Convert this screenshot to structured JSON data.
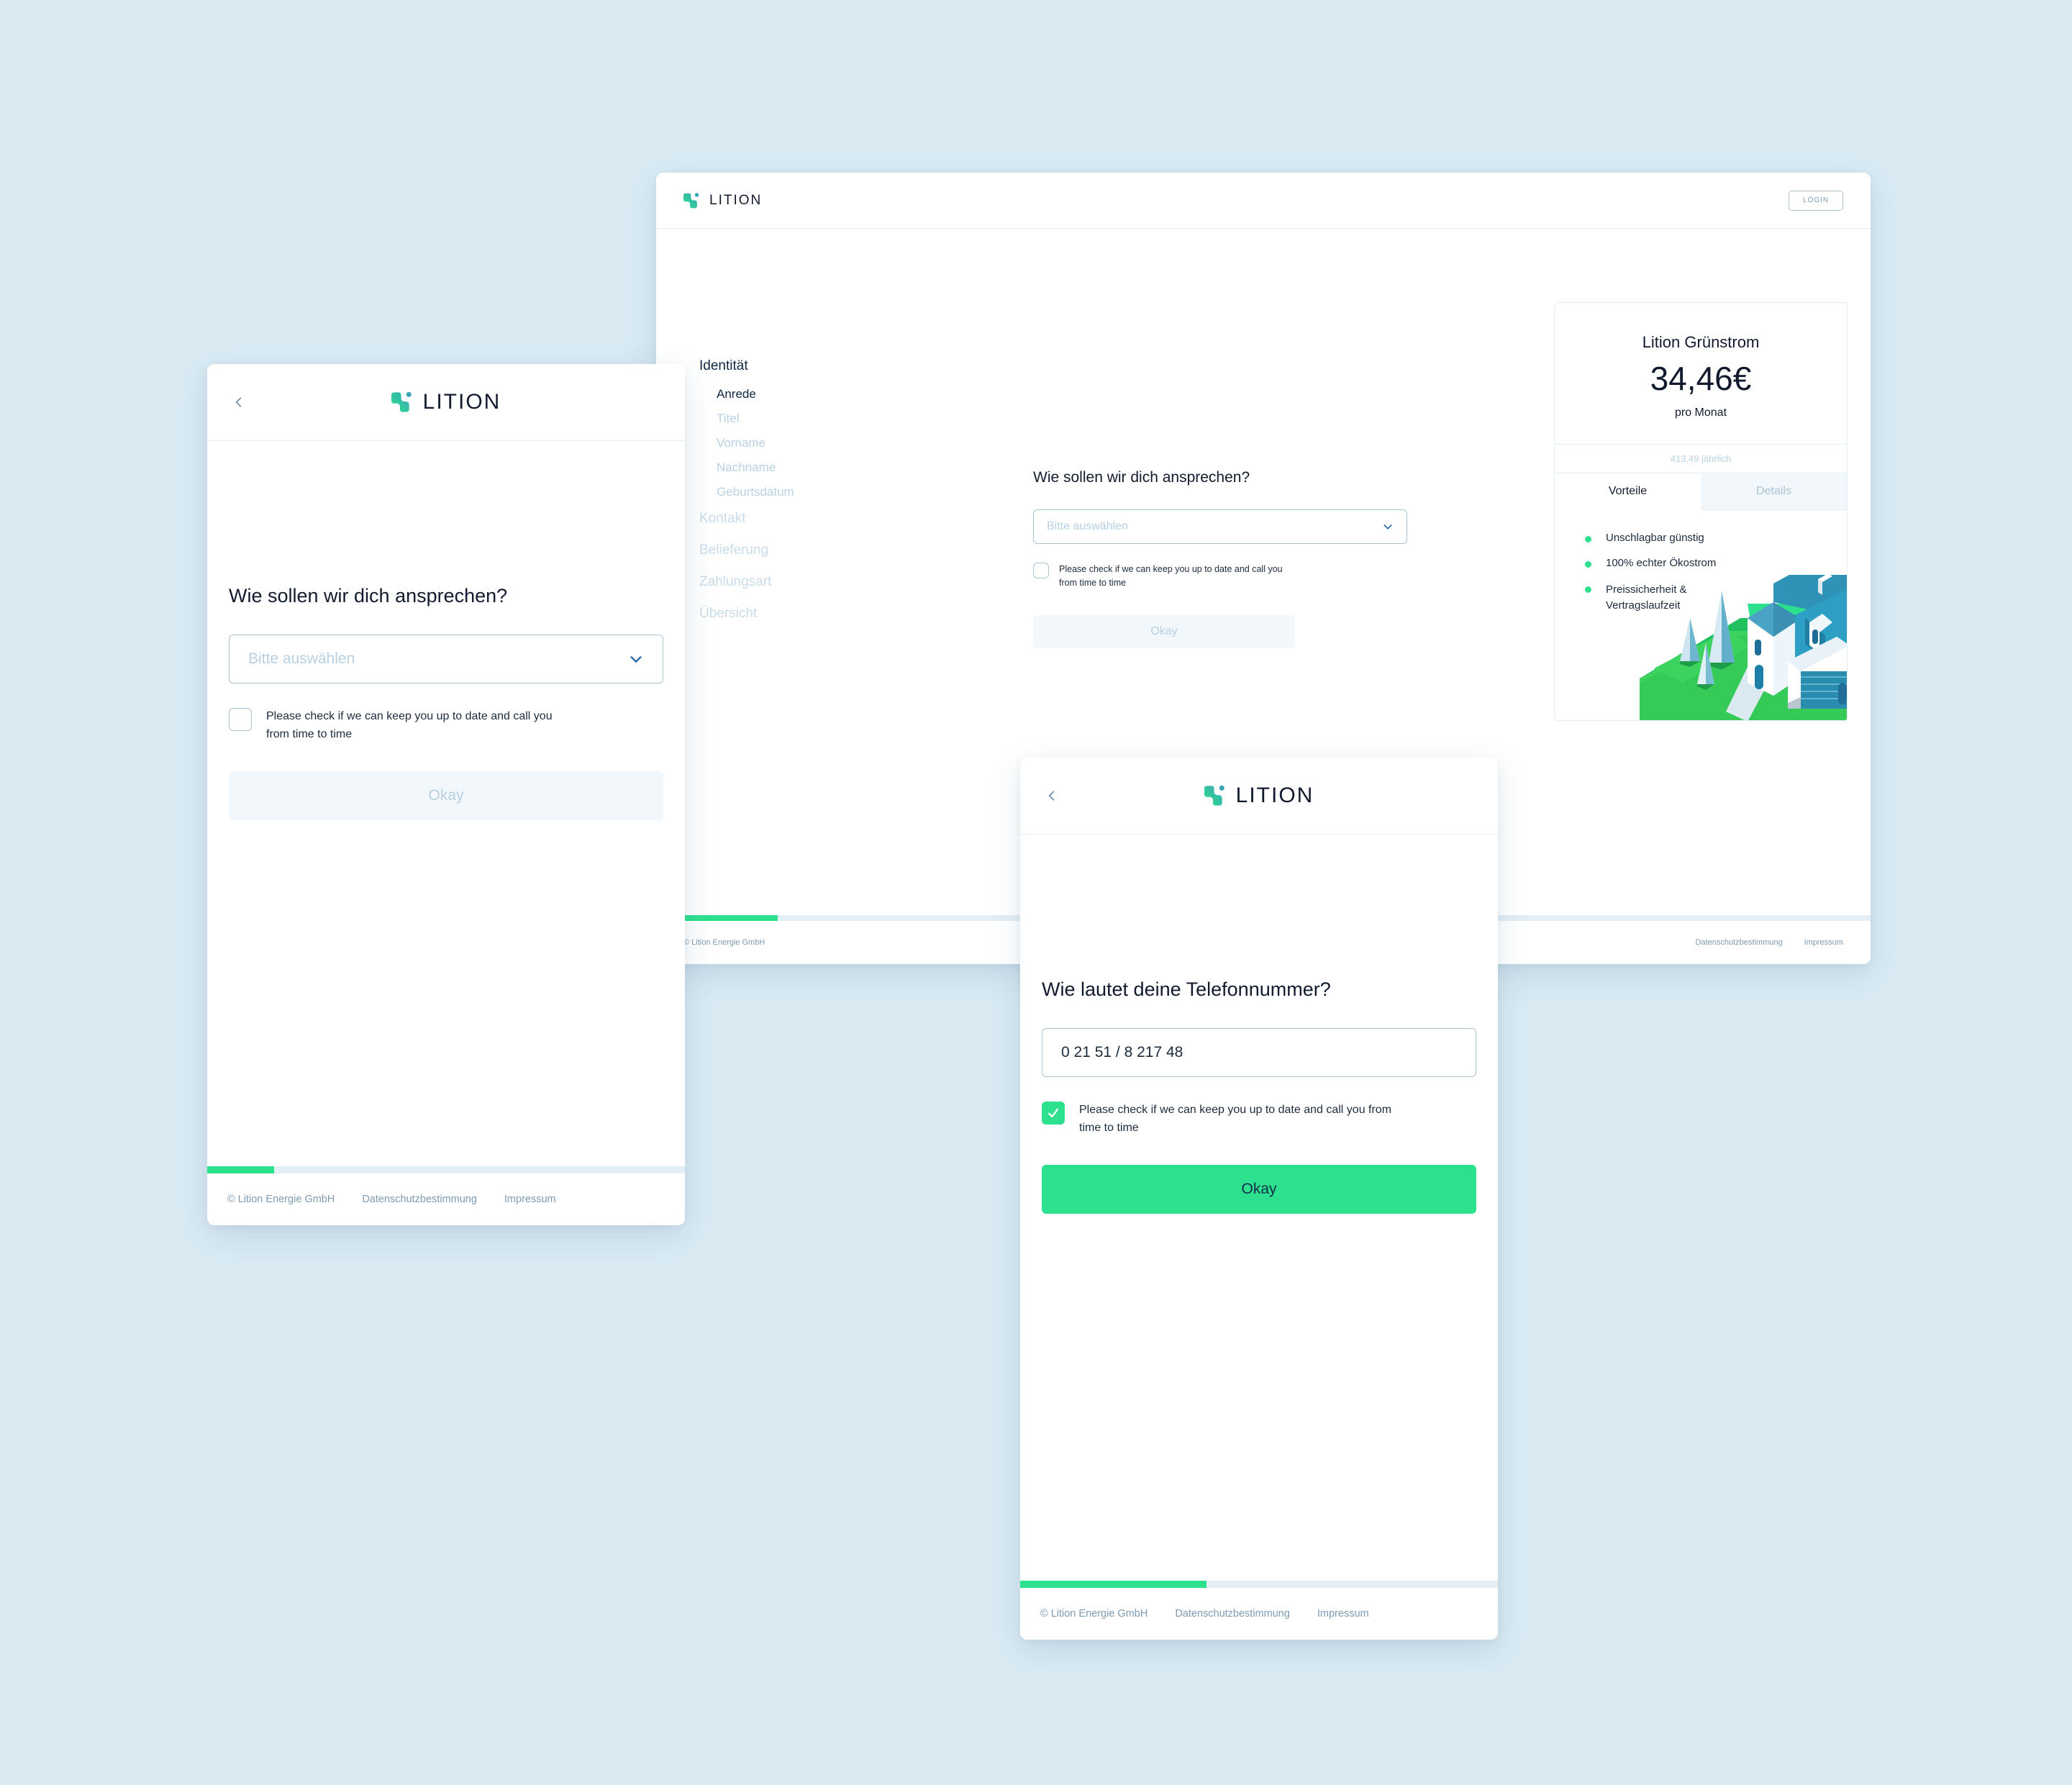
{
  "brand": {
    "name": "LITION",
    "accent_green": "#2de08e",
    "accent_teal": "#3fb6a8",
    "dark": "#121a2e",
    "page_background": "#d9eaf3"
  },
  "mobile_salutation": {
    "back_icon": "chevron-left-icon",
    "logo_text": "LITION",
    "question": "Wie sollen wir dich ansprechen?",
    "select_placeholder": "Bitte auswählen",
    "select_chevron_icon": "chevron-down-icon",
    "checkbox_checked": false,
    "checkbox_label": "Please check if we can keep you up to date and call you from time to time",
    "okay_label": "Okay",
    "okay_enabled": false,
    "progress_percent": 14,
    "footer": {
      "copyright": "© Lition Energie GmbH",
      "privacy": "Datenschutzbestimmung",
      "imprint": "Impressum"
    }
  },
  "desktop": {
    "logo_text": "LITION",
    "login_label": "LOGIN",
    "nav": [
      {
        "label": "Identität",
        "active": true,
        "children": [
          {
            "label": "Anrede",
            "active": true
          },
          {
            "label": "Titel",
            "active": false
          },
          {
            "label": "Vorname",
            "active": false
          },
          {
            "label": "Nachname",
            "active": false
          },
          {
            "label": "Geburtsdatum",
            "active": false
          }
        ]
      },
      {
        "label": "Kontakt",
        "active": false,
        "children": []
      },
      {
        "label": "Belieferung",
        "active": false,
        "children": []
      },
      {
        "label": "Zahlungsart",
        "active": false,
        "children": []
      },
      {
        "label": "Übersicht",
        "active": false,
        "children": []
      }
    ],
    "form": {
      "question": "Wie sollen wir dich ansprechen?",
      "select_placeholder": "Bitte auswählen",
      "select_chevron_icon": "chevron-down-icon",
      "checkbox_checked": false,
      "checkbox_label": "Please check if we can keep you up to date and call you from time to time",
      "okay_label": "Okay",
      "okay_enabled": false
    },
    "price_card": {
      "product_name": "Lition Grünstrom",
      "price": "34,46€",
      "period": "pro Monat",
      "yearly": "413,49 jährlich",
      "tabs": [
        {
          "label": "Vorteile",
          "active": true
        },
        {
          "label": "Details",
          "active": false
        }
      ],
      "benefits": [
        "Unschlagbar günstig",
        "100% echter Ökostrom",
        "Preissicherheit & Vertragslaufzeit"
      ],
      "illustration": "isometric-house-illustration"
    },
    "progress_percent": 10,
    "footer": {
      "copyright": "© Lition Energie GmbH",
      "privacy": "Datenschutzbestimmung",
      "imprint": "Impressum"
    }
  },
  "mobile_phone": {
    "back_icon": "chevron-left-icon",
    "logo_text": "LITION",
    "question": "Wie lautet deine Telefonnummer?",
    "phone_value": "0 21 51 / 8 217 48",
    "checkbox_checked": true,
    "checkbox_label": "Please check if we can keep you up to date and call you from time to time",
    "okay_label": "Okay",
    "okay_enabled": true,
    "progress_percent": 39,
    "footer": {
      "copyright": "© Lition Energie GmbH",
      "privacy": "Datenschutzbestimmung",
      "imprint": "Impressum"
    }
  }
}
